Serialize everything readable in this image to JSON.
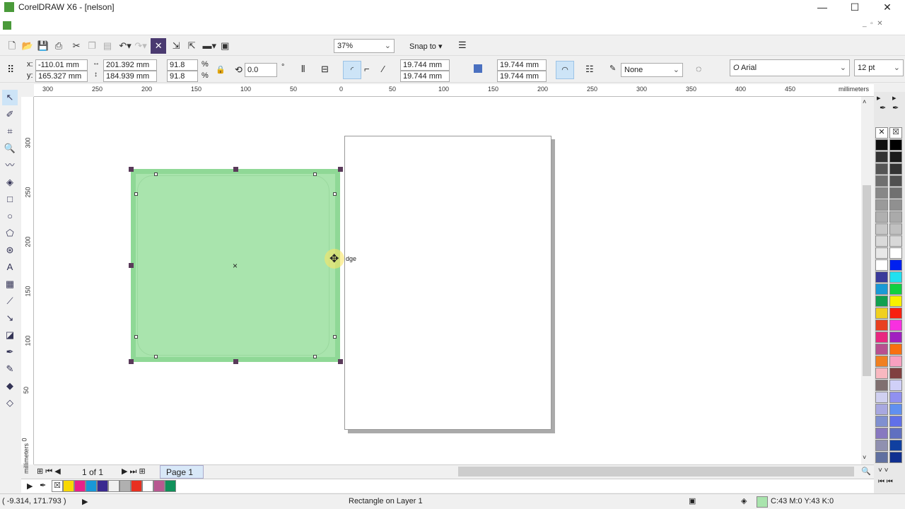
{
  "window": {
    "title": "CorelDRAW X6 - [nelson]",
    "minimize": "—",
    "maximize": "☐",
    "close": "✕"
  },
  "toolbar": {
    "zoom": "37%",
    "snap_to": "Snap to"
  },
  "propbar": {
    "x_label": "x:",
    "x": "-110.01 mm",
    "y_label": "y:",
    "y": "165.327 mm",
    "width": "201.392 mm",
    "height": "184.939 mm",
    "scale_x": "91.8",
    "scale_y": "91.8",
    "pct": "%",
    "rotation": "0.0",
    "deg": "°",
    "corner_tl": "19.744 mm",
    "corner_bl": "19.744 mm",
    "corner_tr": "19.744 mm",
    "corner_br": "19.744 mm",
    "outline": "None",
    "font": "Arial",
    "font_size": "12 pt"
  },
  "rulers": {
    "h_labels": [
      "300",
      "250",
      "200",
      "150",
      "100",
      "50",
      "0",
      "50",
      "100",
      "150",
      "200",
      "250",
      "300",
      "350",
      "400",
      "450"
    ],
    "units": "millimeters",
    "v_labels": [
      "300",
      "250",
      "200",
      "150",
      "100",
      "50",
      "0"
    ]
  },
  "canvas": {
    "snap_hint": "dge"
  },
  "pager": {
    "count": "1 of 1",
    "tab": "Page 1"
  },
  "doc_palette": [
    "#f8d800",
    "#e8208a",
    "#1898d8",
    "#3a2a90",
    "#f0f0f0",
    "#b0b0b0",
    "#e83020",
    "#ffffff",
    "#b85890",
    "#10905a"
  ],
  "palette": {
    "col1": [
      "#111111",
      "#333333",
      "#555555",
      "#707070",
      "#888888",
      "#9a9a9a",
      "#b0b0b0",
      "#c8c8c8",
      "#dadada",
      "#e8e8e8",
      "#ffffff",
      "#3a3a9a",
      "#1a9ad6",
      "#10a050",
      "#f0d020",
      "#e84020",
      "#e82880",
      "#b85090",
      "#f08020",
      "#f8b8c0",
      "#807070",
      "#d0d0f0",
      "#a8a8e0",
      "#8090d0",
      "#8878c0",
      "#9090b0",
      "#6070a0"
    ],
    "col2": [
      "#000000",
      "#1a1a1a",
      "#333333",
      "#505050",
      "#707070",
      "#909090",
      "#aaaaaa",
      "#c0c0c0",
      "#d8d8d8",
      "#ffffff",
      "#0020f0",
      "#20e0f0",
      "#10d040",
      "#f8f000",
      "#f82010",
      "#f830e0",
      "#a020c0",
      "#f87010",
      "#f8a0c0",
      "#804040",
      "#d0d0f8",
      "#9090f0",
      "#6090f0",
      "#6070e8",
      "#6070c0",
      "#1040a0",
      "#103090"
    ]
  },
  "status": {
    "coords": "( -9.314, 171.793 )",
    "object": "Rectangle on Layer 1",
    "fill": "C:43 M:0 Y:43 K:0",
    "fill_color": "#a9e4ad"
  }
}
